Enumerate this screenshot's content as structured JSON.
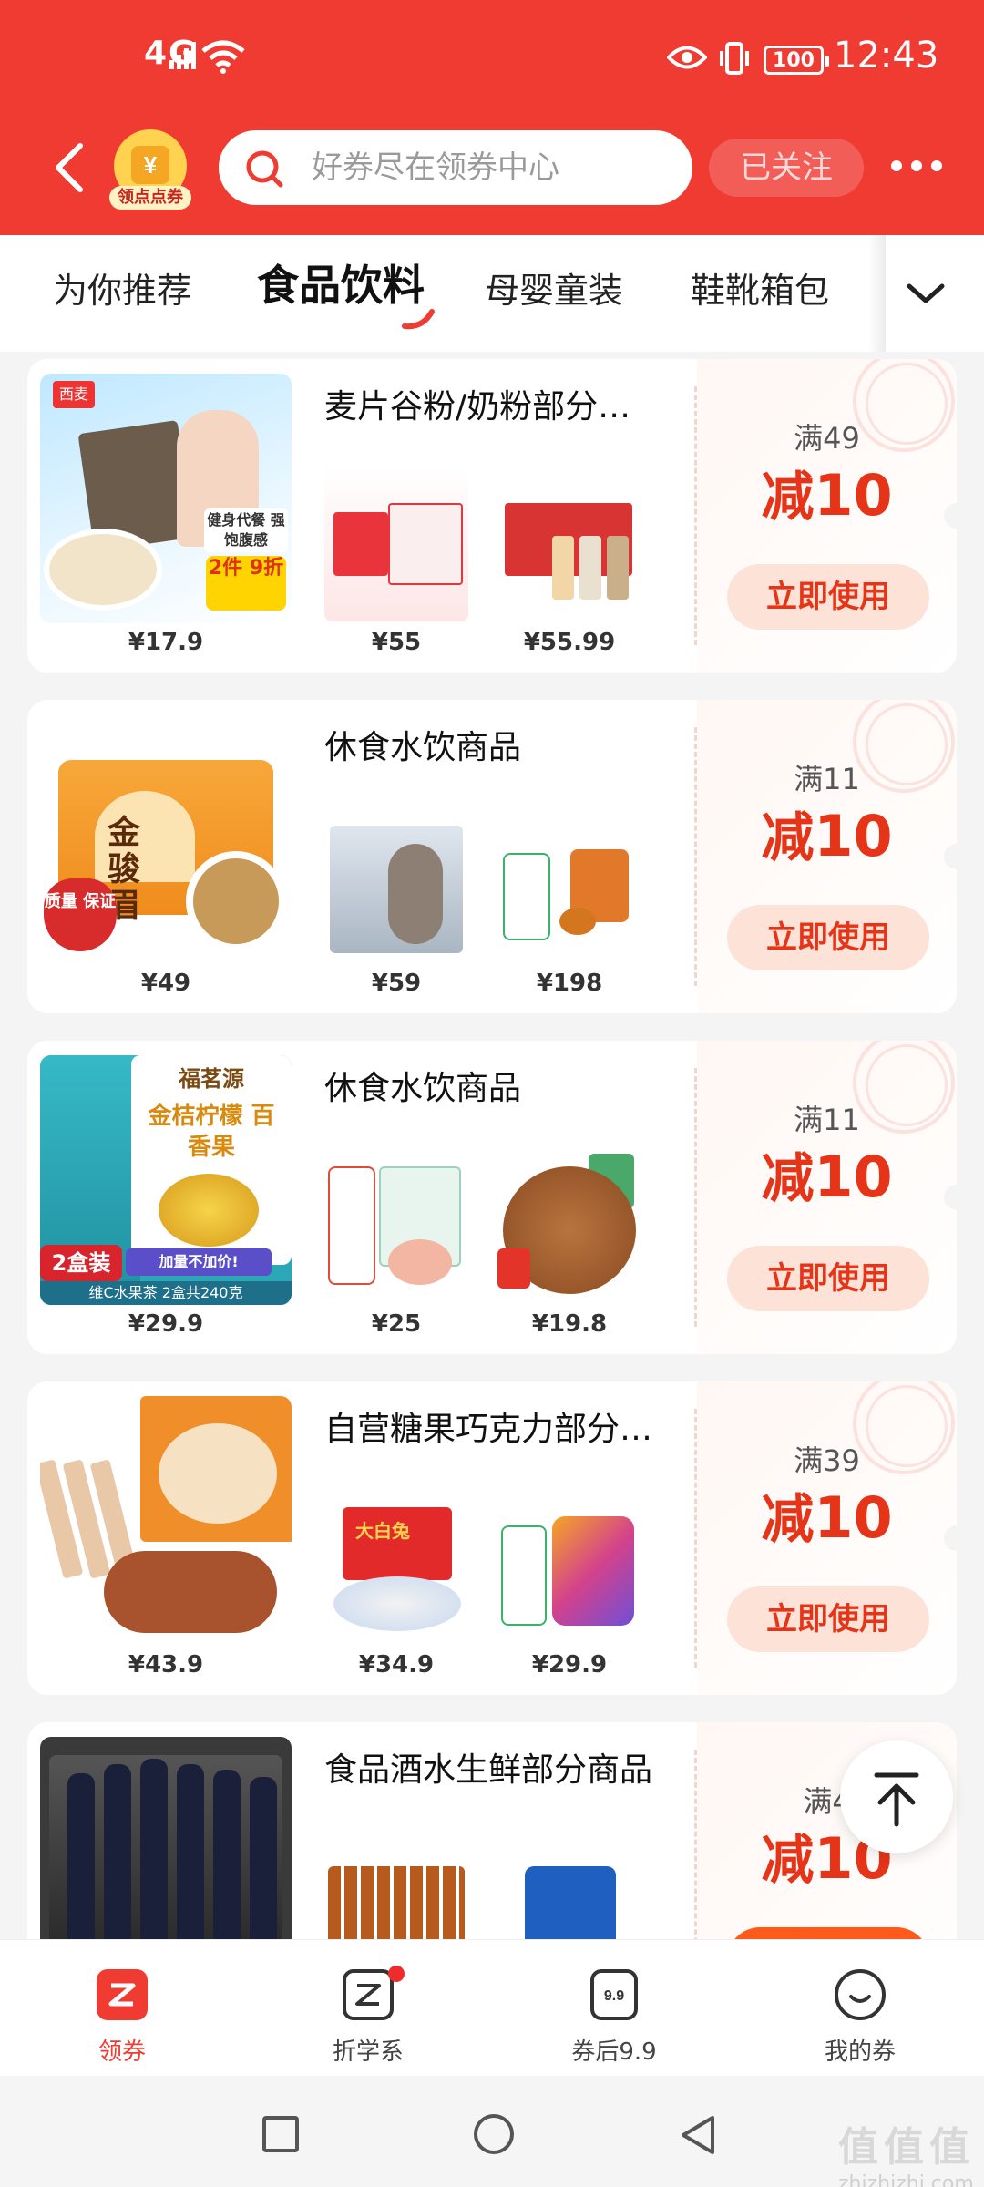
{
  "status_bar": {
    "network": "4G",
    "battery": "100",
    "time": "12:43"
  },
  "header": {
    "coin_label": "领点点券",
    "search_placeholder": "好券尽在领券中心",
    "follow_label": "已关注"
  },
  "tabs": [
    "为你推荐",
    "食品饮料",
    "母婴童装",
    "鞋靴箱包"
  ],
  "active_tab_index": 1,
  "colors": {
    "brand": "#ef3b32",
    "accent_text": "#e53417",
    "button_bg": "#fde2d7"
  },
  "cards": [
    {
      "title": "麦片谷粉/奶粉部分…",
      "main_price": "¥17.9",
      "sub1_price": "¥55",
      "sub2_price": "¥55.99",
      "threshold": "满49",
      "discount_prefix": "减",
      "discount_value": "10",
      "button": "立即使用"
    },
    {
      "title": "休食水饮商品",
      "main_price": "¥49",
      "sub1_price": "¥59",
      "sub2_price": "¥198",
      "threshold": "满11",
      "discount_prefix": "减",
      "discount_value": "10",
      "button": "立即使用"
    },
    {
      "title": "休食水饮商品",
      "main_price": "¥29.9",
      "sub1_price": "¥25",
      "sub2_price": "¥19.8",
      "threshold": "满11",
      "discount_prefix": "减",
      "discount_value": "10",
      "button": "立即使用"
    },
    {
      "title": "自营糖果巧克力部分…",
      "main_price": "¥43.9",
      "sub1_price": "¥34.9",
      "sub2_price": "¥29.9",
      "threshold": "满39",
      "discount_prefix": "减",
      "discount_value": "10",
      "button": "立即使用"
    },
    {
      "title": "食品酒水生鲜部分商品",
      "main_price": "",
      "sub1_price": "",
      "sub2_price": "",
      "threshold": "满4",
      "discount_prefix": "减",
      "discount_value": "10",
      "button": ""
    }
  ],
  "product_labels": {
    "card1_badge": "健身代餐 强饱腹感",
    "card1_promo": "2件 9折",
    "card1_brand": "西麦",
    "card2_can": "金骏眉",
    "card2_badge": "质量 保证",
    "card3_brand": "福茗源",
    "card3_can": "金桔柠檬 百香果",
    "card3_promo": "2盒装",
    "card3_promo2": "加量不加价!",
    "card3_desc": "维C水果茶 2盒共240克",
    "card4_candy": "大白兔"
  },
  "bottom_nav": [
    {
      "label": "领券",
      "icon": "coupon-icon"
    },
    {
      "label": "折学系",
      "icon": "z-icon"
    },
    {
      "label": "券后9.9",
      "icon": "price-tag-icon",
      "icon_text": "9.9"
    },
    {
      "label": "我的券",
      "icon": "smile-icon"
    }
  ],
  "watermark": {
    "big": "值值值",
    "small": "zhizhizhi.com"
  }
}
